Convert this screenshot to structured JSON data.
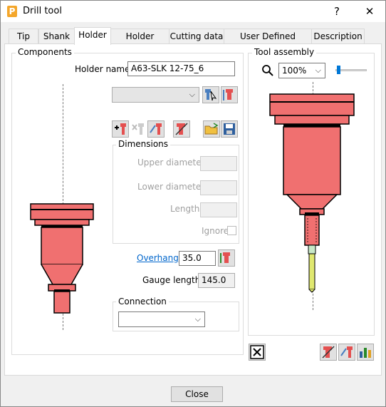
{
  "window": {
    "title": "Drill tool",
    "help_label": "?",
    "close_label": "✕",
    "app_icon_label": "P"
  },
  "tabs": [
    {
      "label": "Tip"
    },
    {
      "label": "Shank"
    },
    {
      "label": "Holder",
      "active": true
    },
    {
      "label": "Holder profile"
    },
    {
      "label": "Cutting data"
    },
    {
      "label": "User Defined Settings"
    },
    {
      "label": "Description"
    }
  ],
  "components": {
    "legend": "Components",
    "holder_name_label": "Holder name",
    "holder_name_value": "A63-SLK 12-75_6",
    "holder_select_value": "",
    "dimensions": {
      "legend": "Dimensions",
      "upper_diameter_label": "Upper diameter",
      "lower_diameter_label": "Lower diameter",
      "length_label": "Length",
      "ignore_label": "Ignore"
    },
    "overhang_label": "Overhang",
    "overhang_value": "35.0",
    "gauge_length_label": "Gauge length",
    "gauge_length_value": "145.0",
    "connection": {
      "legend": "Connection",
      "value": ""
    }
  },
  "tool_assembly": {
    "legend": "Tool assembly",
    "zoom_value": "100%",
    "zoom_slider_level": 0.05
  },
  "footer": {
    "close_label": "Close"
  },
  "colors": {
    "holder_fill": "#f07070",
    "tip_fill": "#e0e870",
    "link": "#0066cc"
  }
}
